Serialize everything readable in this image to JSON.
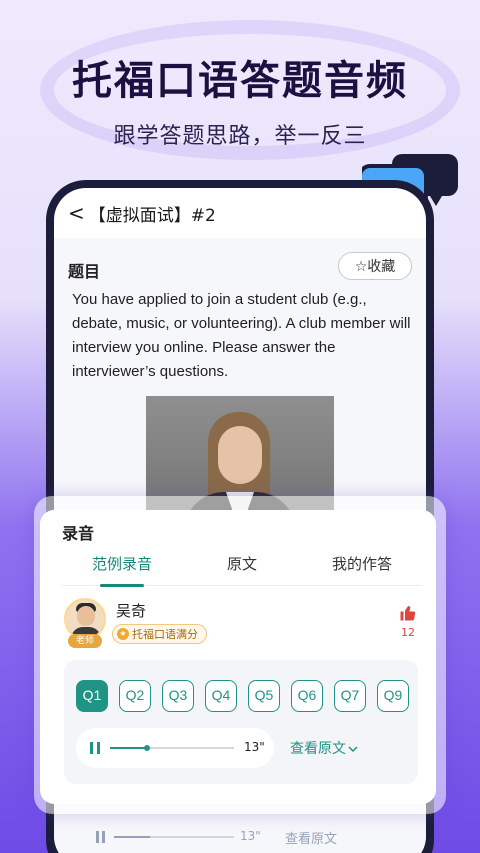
{
  "hero": {
    "title": "托福口语答题音频",
    "subtitle": "跟学答题思路，举一反三"
  },
  "nav": {
    "back_glyph": "<",
    "title": "【虚拟面试】#2"
  },
  "question": {
    "label": "题目",
    "favorite_label": "☆收藏",
    "text": "You have applied to join a student club (e.g., debate, music, or volunteering). A club member will interview you online. Please answer the interviewer’s questions."
  },
  "recording": {
    "title": "录音",
    "tabs": [
      {
        "label": "范例录音",
        "active": true
      },
      {
        "label": "原文",
        "active": false
      },
      {
        "label": "我的作答",
        "active": false
      }
    ],
    "teacher": {
      "name": "吴奇",
      "badge": "老师",
      "tag": "托福口语满分"
    },
    "likes": "12",
    "questions": [
      "Q1",
      "Q2",
      "Q3",
      "Q4",
      "Q5",
      "Q6",
      "Q7",
      "Q9"
    ],
    "active_question": "Q1",
    "player": {
      "duration": "13\"",
      "progress": 0.3
    },
    "view_original": "查看原文"
  },
  "ghost_player": {
    "duration": "13\"",
    "view_original": "查看原文"
  },
  "colors": {
    "accent": "#1f9485",
    "brand_purple": "#6e4be6",
    "like_red": "#e0443f"
  },
  "icons": [
    "chat-bubbles-icon",
    "back-arrow-icon",
    "star-icon",
    "pause-icon",
    "chevron-down-icon",
    "thumbs-up-icon",
    "medal-icon"
  ]
}
